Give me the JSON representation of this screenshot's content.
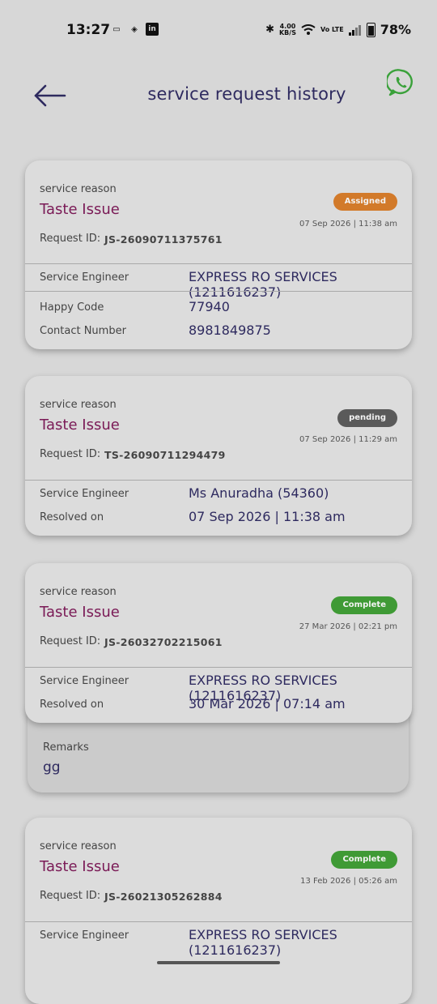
{
  "status_bar": {
    "time": "13:27",
    "speed_top": "4.00",
    "speed_bottom": "KB/S",
    "volte": "Vo LTE",
    "battery": "78%"
  },
  "header": {
    "title": "service request history",
    "back_icon": "arrow-left-icon",
    "whatsapp_icon": "whatsapp-icon"
  },
  "colors": {
    "assigned": "#d27a2a",
    "pending": "#5a5a5a",
    "complete": "#3f9a35",
    "reason": "#7a1a56",
    "value": "#2e2a5f"
  },
  "requests": [
    {
      "reason_label": "service reason",
      "reason": "Taste Issue",
      "status": "Assigned",
      "date": "07 Sep 2026 | 11:38 am",
      "request_id_label": "Request ID:",
      "request_id": "JS-26090711375761",
      "rows": [
        {
          "label": "Service Engineer",
          "value": "EXPRESS RO SERVICES (1211616237)"
        },
        {
          "label": "Happy Code",
          "value": "77940"
        },
        {
          "label": "Contact Number",
          "value": "8981849875"
        }
      ]
    },
    {
      "reason_label": "service reason",
      "reason": "Taste Issue",
      "status": "pending",
      "date": "07 Sep 2026 | 11:29 am",
      "request_id_label": "Request ID:",
      "request_id": "TS-26090711294479",
      "rows": [
        {
          "label": "Service Engineer",
          "value": "Ms Anuradha (54360)"
        },
        {
          "label": "Resolved on",
          "value": "07 Sep 2026 | 11:38 am"
        }
      ]
    },
    {
      "reason_label": "service reason",
      "reason": "Taste Issue",
      "status": "Complete",
      "date": "27 Mar 2026 | 02:21 pm",
      "request_id_label": "Request ID:",
      "request_id": "JS-26032702215061",
      "rows": [
        {
          "label": "Service Engineer",
          "value": "EXPRESS RO SERVICES (1211616237)"
        },
        {
          "label": "Resolved on",
          "value": "30 Mar 2026 | 07:14 am"
        }
      ],
      "remarks_label": "Remarks",
      "remarks": "gg"
    },
    {
      "reason_label": "service reason",
      "reason": "Taste Issue",
      "status": "Complete",
      "date": "13 Feb 2026 | 05:26 am",
      "request_id_label": "Request ID:",
      "request_id": "JS-26021305262884",
      "rows": [
        {
          "label": "Service Engineer",
          "value": "EXPRESS RO SERVICES (1211616237)"
        }
      ]
    }
  ]
}
